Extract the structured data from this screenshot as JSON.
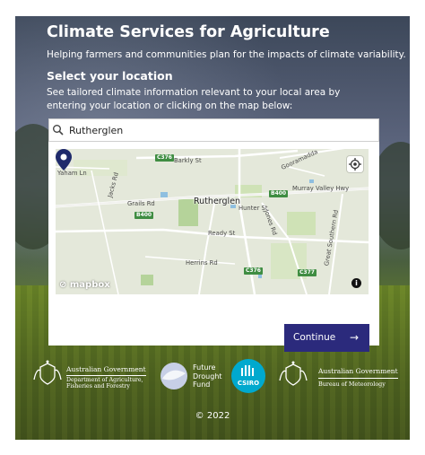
{
  "header": {
    "title": "Climate Services for Agriculture",
    "subtitle": "Helping farmers and communities plan for the impacts of climate variability."
  },
  "location": {
    "heading": "Select your location",
    "description": "See tailored climate information relevant to your local area by entering your location or clicking on the map below:"
  },
  "search": {
    "value": "Rutherglen",
    "icon": "search-icon"
  },
  "map": {
    "town": "Rutherglen",
    "streets": [
      "Barkly St",
      "Yaham Ln",
      "Jacks Rd",
      "Grails Rd",
      "Murray Valley Hwy",
      "Hunter St",
      "Ready St",
      "Jones Rd",
      "Herrins Rd",
      "Great Southern Rd",
      "Gooramadda"
    ],
    "road_shields": [
      "C376",
      "B400",
      "B400",
      "C376",
      "C377"
    ],
    "attribution": "mapbox",
    "info_button": "i"
  },
  "actions": {
    "continue_label": "Continue",
    "continue_color": "#2b2a7c"
  },
  "footer": {
    "logos": {
      "dept": {
        "line1": "Australian Government",
        "line2": "Department of Agriculture,",
        "line3": "Fisheries and Forestry"
      },
      "fdf": {
        "line1": "Future",
        "line2": "Drought",
        "line3": "Fund"
      },
      "csiro": "CSIRO",
      "bom": {
        "line1": "Australian Government",
        "line2": "Bureau of Meteorology"
      }
    },
    "copyright": "© 2022"
  }
}
